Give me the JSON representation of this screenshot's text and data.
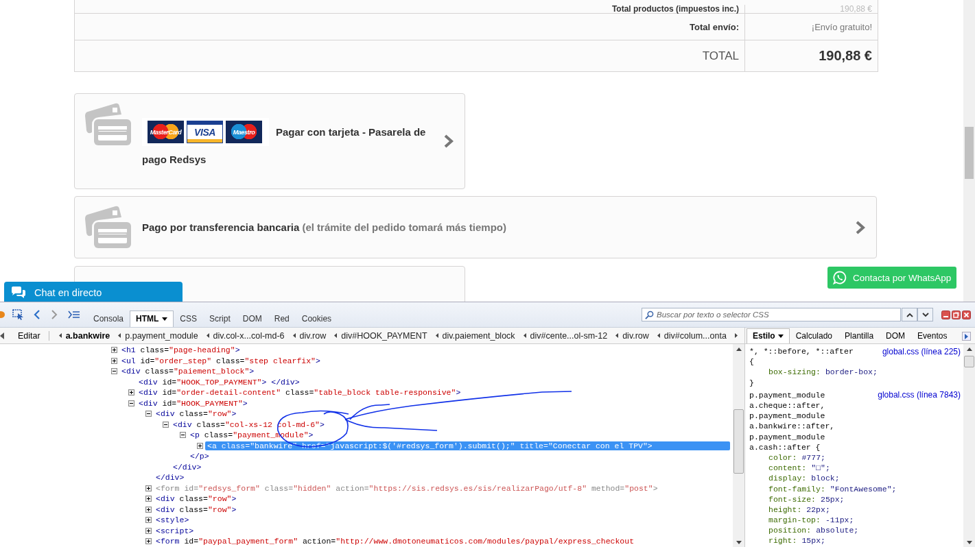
{
  "page": {
    "summary_rows": [
      {
        "kind": "subtotal",
        "label": "Total productos (impuestos inc.)",
        "value": "190,88 €"
      },
      {
        "kind": "shipping",
        "label": "Total envío:",
        "value": "¡Envío gratuito!"
      },
      {
        "kind": "total",
        "label": "TOTAL",
        "value": "190,88 €"
      }
    ],
    "payment_options": [
      {
        "kind": "card",
        "logos": [
          {
            "kind": "mastercard",
            "text": "MasterCard"
          },
          {
            "kind": "visa",
            "text": "VISA"
          },
          {
            "kind": "maestro",
            "text": "Maestro"
          }
        ],
        "title_lines": [
          "Pagar con tarjeta - Pasarela de",
          "pago Redsys"
        ]
      },
      {
        "kind": "bankwire",
        "title": "Pago por transferencia bancaria",
        "note": "(el trámite del pedido tomará más tiempo)"
      },
      {
        "kind": "partial"
      }
    ],
    "chat_button": "Chat en directo",
    "whatsapp_button": "Contacta por WhatsApp"
  },
  "devtools": {
    "tabs": [
      {
        "label": "Consola",
        "selected": false,
        "menu": false
      },
      {
        "label": "HTML",
        "selected": true,
        "menu": true
      },
      {
        "label": "CSS",
        "selected": false,
        "menu": false
      },
      {
        "label": "Script",
        "selected": false,
        "menu": false
      },
      {
        "label": "DOM",
        "selected": false,
        "menu": false
      },
      {
        "label": "Red",
        "selected": false,
        "menu": false
      },
      {
        "label": "Cookies",
        "selected": false,
        "menu": false
      }
    ],
    "search": {
      "placeholder": "Buscar por texto o selector CSS"
    },
    "edit_button": "Editar",
    "breadcrumbs": [
      {
        "label": "a.bankwire",
        "selected": true
      },
      {
        "label": "p.payment_module",
        "selected": false
      },
      {
        "label": "div.col-x...col-md-6",
        "selected": false
      },
      {
        "label": "div.row",
        "selected": false
      },
      {
        "label": "div#HOOK_PAYMENT",
        "selected": false
      },
      {
        "label": "div.paiement_block",
        "selected": false
      },
      {
        "label": "div#cente...ol-sm-12",
        "selected": false
      },
      {
        "label": "div.row",
        "selected": false
      },
      {
        "label": "div#colum...onta",
        "selected": false
      }
    ],
    "side_tabs": [
      {
        "label": "Estilo",
        "selected": true,
        "menu": true
      },
      {
        "label": "Calculado",
        "selected": false,
        "menu": false
      },
      {
        "label": "Plantilla",
        "selected": false,
        "menu": false
      },
      {
        "label": "DOM",
        "selected": false,
        "menu": false
      },
      {
        "label": "Eventos",
        "selected": false,
        "menu": false
      }
    ],
    "tree": [
      {
        "kind": "element",
        "expanded": false,
        "selected": false,
        "greyed": false,
        "parts": [
          {
            "kind": "tag",
            "text": "<h1"
          },
          {
            "kind": "attr",
            "text": " class="
          },
          {
            "kind": "value",
            "text": "\"page-heading\""
          },
          {
            "kind": "tag",
            "text": ">"
          }
        ]
      },
      {
        "kind": "element",
        "expanded": false,
        "selected": false,
        "greyed": false,
        "parts": [
          {
            "kind": "tag",
            "text": "<ul"
          },
          {
            "kind": "attr",
            "text": " id="
          },
          {
            "kind": "value",
            "text": "\"order_step\""
          },
          {
            "kind": "attr",
            "text": " class="
          },
          {
            "kind": "value",
            "text": "\"step clearfix\""
          },
          {
            "kind": "tag",
            "text": ">"
          }
        ]
      },
      {
        "kind": "element",
        "expanded": true,
        "selected": false,
        "greyed": false,
        "parts": [
          {
            "kind": "tag",
            "text": "<div"
          },
          {
            "kind": "attr",
            "text": " class="
          },
          {
            "kind": "value",
            "text": "\"paiement_block\""
          },
          {
            "kind": "tag",
            "text": ">"
          }
        ],
        "children": [
          {
            "kind": "empty",
            "selected": false,
            "greyed": false,
            "parts": [
              {
                "kind": "tag",
                "text": "<div"
              },
              {
                "kind": "attr",
                "text": " id="
              },
              {
                "kind": "value",
                "text": "\"HOOK_TOP_PAYMENT\""
              },
              {
                "kind": "tag",
                "text": "> </div>"
              }
            ]
          },
          {
            "kind": "element",
            "expanded": false,
            "selected": false,
            "greyed": false,
            "parts": [
              {
                "kind": "tag",
                "text": "<div"
              },
              {
                "kind": "attr",
                "text": " id="
              },
              {
                "kind": "value",
                "text": "\"order-detail-content\""
              },
              {
                "kind": "attr",
                "text": " class="
              },
              {
                "kind": "value",
                "text": "\"table_block table-responsive\""
              },
              {
                "kind": "tag",
                "text": ">"
              }
            ]
          },
          {
            "kind": "element",
            "expanded": true,
            "selected": false,
            "greyed": false,
            "parts": [
              {
                "kind": "tag",
                "text": "<div"
              },
              {
                "kind": "attr",
                "text": " id="
              },
              {
                "kind": "value",
                "text": "\"HOOK_PAYMENT\""
              },
              {
                "kind": "tag",
                "text": ">"
              }
            ],
            "children": [
              {
                "kind": "element",
                "expanded": true,
                "selected": false,
                "greyed": false,
                "parts": [
                  {
                    "kind": "tag",
                    "text": "<div"
                  },
                  {
                    "kind": "attr",
                    "text": " class="
                  },
                  {
                    "kind": "value",
                    "text": "\"row\""
                  },
                  {
                    "kind": "tag",
                    "text": ">"
                  }
                ],
                "close": "</div>",
                "children": [
                  {
                    "kind": "element",
                    "expanded": true,
                    "selected": false,
                    "greyed": false,
                    "parts": [
                      {
                        "kind": "tag",
                        "text": "<div"
                      },
                      {
                        "kind": "attr",
                        "text": " class="
                      },
                      {
                        "kind": "value",
                        "text": "\"col-xs-12 col-md-6\""
                      },
                      {
                        "kind": "tag",
                        "text": ">"
                      }
                    ],
                    "close": "</div>",
                    "children": [
                      {
                        "kind": "element",
                        "expanded": true,
                        "selected": false,
                        "greyed": false,
                        "parts": [
                          {
                            "kind": "tag",
                            "text": "<p"
                          },
                          {
                            "kind": "attr",
                            "text": " class="
                          },
                          {
                            "kind": "value",
                            "text": "\"payment_module\""
                          },
                          {
                            "kind": "tag",
                            "text": ">"
                          }
                        ],
                        "close": "</p>",
                        "children": [
                          {
                            "kind": "element",
                            "expanded": false,
                            "selected": true,
                            "greyed": false,
                            "parts": [
                              {
                                "kind": "tag",
                                "text": "<a"
                              },
                              {
                                "kind": "attr",
                                "text": " class="
                              },
                              {
                                "kind": "value",
                                "text": "\"bankwire\""
                              },
                              {
                                "kind": "attr",
                                "text": " href="
                              },
                              {
                                "kind": "value",
                                "text": "\"javascript:$('#redsys_form').submit();\""
                              },
                              {
                                "kind": "attr",
                                "text": " title="
                              },
                              {
                                "kind": "value",
                                "text": "\"Conectar con el TPV\""
                              },
                              {
                                "kind": "tag",
                                "text": ">"
                              }
                            ]
                          }
                        ]
                      }
                    ]
                  }
                ]
              },
              {
                "kind": "element",
                "expanded": false,
                "selected": false,
                "greyed": true,
                "parts": [
                  {
                    "kind": "tag",
                    "text": "<form"
                  },
                  {
                    "kind": "attr",
                    "text": " id="
                  },
                  {
                    "kind": "value",
                    "text": "\"redsys_form\""
                  },
                  {
                    "kind": "attr",
                    "text": " class="
                  },
                  {
                    "kind": "value",
                    "text": "\"hidden\""
                  },
                  {
                    "kind": "attr",
                    "text": " action="
                  },
                  {
                    "kind": "value",
                    "text": "\"https://sis.redsys.es/sis/realizarPago/utf-8\""
                  },
                  {
                    "kind": "attr",
                    "text": " method="
                  },
                  {
                    "kind": "value",
                    "text": "\"post\""
                  },
                  {
                    "kind": "tag",
                    "text": ">"
                  }
                ]
              },
              {
                "kind": "element",
                "expanded": false,
                "selected": false,
                "greyed": false,
                "parts": [
                  {
                    "kind": "tag",
                    "text": "<div"
                  },
                  {
                    "kind": "attr",
                    "text": " class="
                  },
                  {
                    "kind": "value",
                    "text": "\"row\""
                  },
                  {
                    "kind": "tag",
                    "text": ">"
                  }
                ]
              },
              {
                "kind": "element",
                "expanded": false,
                "selected": false,
                "greyed": false,
                "parts": [
                  {
                    "kind": "tag",
                    "text": "<div"
                  },
                  {
                    "kind": "attr",
                    "text": " class="
                  },
                  {
                    "kind": "value",
                    "text": "\"row\""
                  },
                  {
                    "kind": "tag",
                    "text": ">"
                  }
                ]
              },
              {
                "kind": "element",
                "expanded": false,
                "selected": false,
                "greyed": false,
                "parts": [
                  {
                    "kind": "tag",
                    "text": "<style>"
                  }
                ]
              },
              {
                "kind": "element",
                "expanded": false,
                "selected": false,
                "greyed": false,
                "parts": [
                  {
                    "kind": "tag",
                    "text": "<script>"
                  }
                ]
              },
              {
                "kind": "element",
                "expanded": false,
                "selected": false,
                "greyed": false,
                "parts": [
                  {
                    "kind": "tag",
                    "text": "<form"
                  },
                  {
                    "kind": "attr",
                    "text": " id="
                  },
                  {
                    "kind": "value",
                    "text": "\"paypal_payment_form\""
                  },
                  {
                    "kind": "attr",
                    "text": " action="
                  },
                  {
                    "kind": "value",
                    "text": "\"http://www.dmotoneumaticos.com/modules/paypal/express_checkout"
                  }
                ]
              }
            ]
          }
        ]
      }
    ],
    "css_rules": [
      {
        "selectors": [
          "*, *::before, *::after",
          "{"
        ],
        "source": "global.css (línea 225)",
        "props": [
          {
            "name": "box-sizing:",
            "value": "border-box;"
          }
        ],
        "close": "}"
      },
      {
        "selectors": [
          "p.payment_module",
          "a.cheque::after,",
          "p.payment_module",
          "a.bankwire::after,",
          "p.payment_module",
          "a.cash::after {"
        ],
        "source": "global.css (línea 7843)",
        "props": [
          {
            "name": "color:",
            "value": "#777;"
          },
          {
            "name": "content:",
            "value": "\"□\";"
          },
          {
            "name": "display:",
            "value": "block;"
          },
          {
            "name": "font-family:",
            "value": "\"FontAwesome\";"
          },
          {
            "name": "font-size:",
            "value": "25px;"
          },
          {
            "name": "height:",
            "value": "22px;"
          },
          {
            "name": "margin-top:",
            "value": "-11px;"
          },
          {
            "name": "position:",
            "value": "absolute;"
          },
          {
            "name": "right:",
            "value": "15px;"
          }
        ]
      }
    ]
  }
}
